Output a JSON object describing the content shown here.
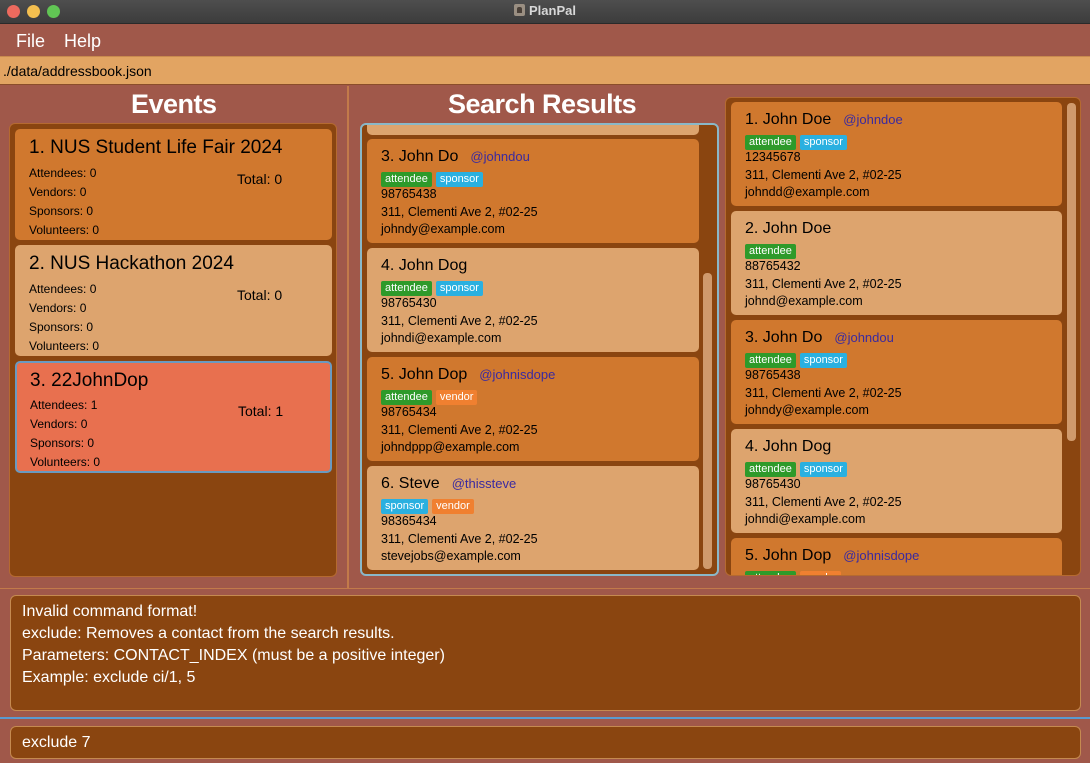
{
  "window": {
    "title": "PlanPal"
  },
  "menu": {
    "file": "File",
    "help": "Help"
  },
  "path": "./data/addressbook.json",
  "events_title": "Events",
  "search_title": "Search Results",
  "events": [
    {
      "name": "1. NUS Student Life Fair 2024",
      "attendees": "Attendees: 0",
      "vendors": "Vendors: 0",
      "sponsors": "Sponsors: 0",
      "volunteers": "Volunteers: 0",
      "total": "Total: 0"
    },
    {
      "name": "2. NUS Hackathon 2024",
      "attendees": "Attendees: 0",
      "vendors": "Vendors: 0",
      "sponsors": "Sponsors: 0",
      "volunteers": "Volunteers: 0",
      "total": "Total: 0"
    },
    {
      "name": "3. 22JohnDop",
      "attendees": "Attendees: 1",
      "vendors": "Vendors: 0",
      "sponsors": "Sponsors: 0",
      "volunteers": "Volunteers: 0",
      "total": "Total: 1"
    }
  ],
  "search_results": [
    {
      "name": "3. John Do",
      "handle": "@johndou",
      "tags": [
        "attendee",
        "sponsor"
      ],
      "phone": "98765438",
      "address": "311, Clementi Ave 2, #02-25",
      "email": "johndy@example.com"
    },
    {
      "name": "4. John Dog",
      "handle": "",
      "tags": [
        "attendee",
        "sponsor"
      ],
      "phone": "98765430",
      "address": "311, Clementi Ave 2, #02-25",
      "email": "johndi@example.com"
    },
    {
      "name": "5. John Dop",
      "handle": "@johnisdope",
      "tags": [
        "attendee",
        "vendor"
      ],
      "phone": "98765434",
      "address": "311, Clementi Ave 2, #02-25",
      "email": "johndppp@example.com"
    },
    {
      "name": "6. Steve",
      "handle": "@thissteve",
      "tags": [
        "sponsor",
        "vendor"
      ],
      "phone": "98365434",
      "address": "311, Clementi Ave 2, #02-25",
      "email": "stevejobs@example.com"
    }
  ],
  "contacts": [
    {
      "name": "1. John Doe",
      "handle": "@johndoe",
      "tags": [
        "attendee",
        "sponsor"
      ],
      "phone": "12345678",
      "address": "311, Clementi Ave 2, #02-25",
      "email": "johndd@example.com"
    },
    {
      "name": "2. John Doe",
      "handle": "",
      "tags": [
        "attendee"
      ],
      "phone": "88765432",
      "address": "311, Clementi Ave 2, #02-25",
      "email": "johnd@example.com"
    },
    {
      "name": "3. John Do",
      "handle": "@johndou",
      "tags": [
        "attendee",
        "sponsor"
      ],
      "phone": "98765438",
      "address": "311, Clementi Ave 2, #02-25",
      "email": "johndy@example.com"
    },
    {
      "name": "4. John Dog",
      "handle": "",
      "tags": [
        "attendee",
        "sponsor"
      ],
      "phone": "98765430",
      "address": "311, Clementi Ave 2, #02-25",
      "email": "johndi@example.com"
    },
    {
      "name": "5. John Dop",
      "handle": "@johnisdope",
      "tags": [
        "attendee",
        "vendor"
      ],
      "phone": "",
      "address": "",
      "email": ""
    }
  ],
  "result": {
    "line1": "Invalid command format!",
    "line2": "exclude: Removes a contact from the search results.",
    "line3": "Parameters: CONTACT_INDEX (must be a positive integer)",
    "line4": "Example: exclude ci/1, 5"
  },
  "command": "exclude 7",
  "colors": {
    "background": "#a0584a",
    "list_bg": "#8a4510",
    "card_dark": "#d0782e",
    "card_light": "#dda46e",
    "selected": "#e8704f"
  }
}
